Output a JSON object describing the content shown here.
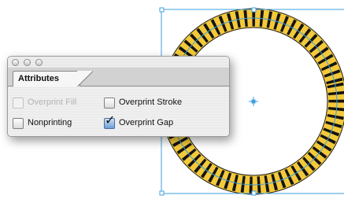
{
  "panel": {
    "tab_label": "Attributes",
    "options": [
      {
        "label": "Overprint Fill",
        "checked": false,
        "enabled": false
      },
      {
        "label": "Overprint Stroke",
        "checked": false,
        "enabled": true
      },
      {
        "label": "Nonprinting",
        "checked": false,
        "enabled": true
      },
      {
        "label": "Overprint Gap",
        "checked": true,
        "enabled": true
      }
    ]
  },
  "artwork": {
    "shape": "circle",
    "stroke_style": "dashed stroke with gap color",
    "dash_color": "#111111",
    "gap_color": "#f3c93a",
    "selection_color": "#3d9fe0"
  }
}
